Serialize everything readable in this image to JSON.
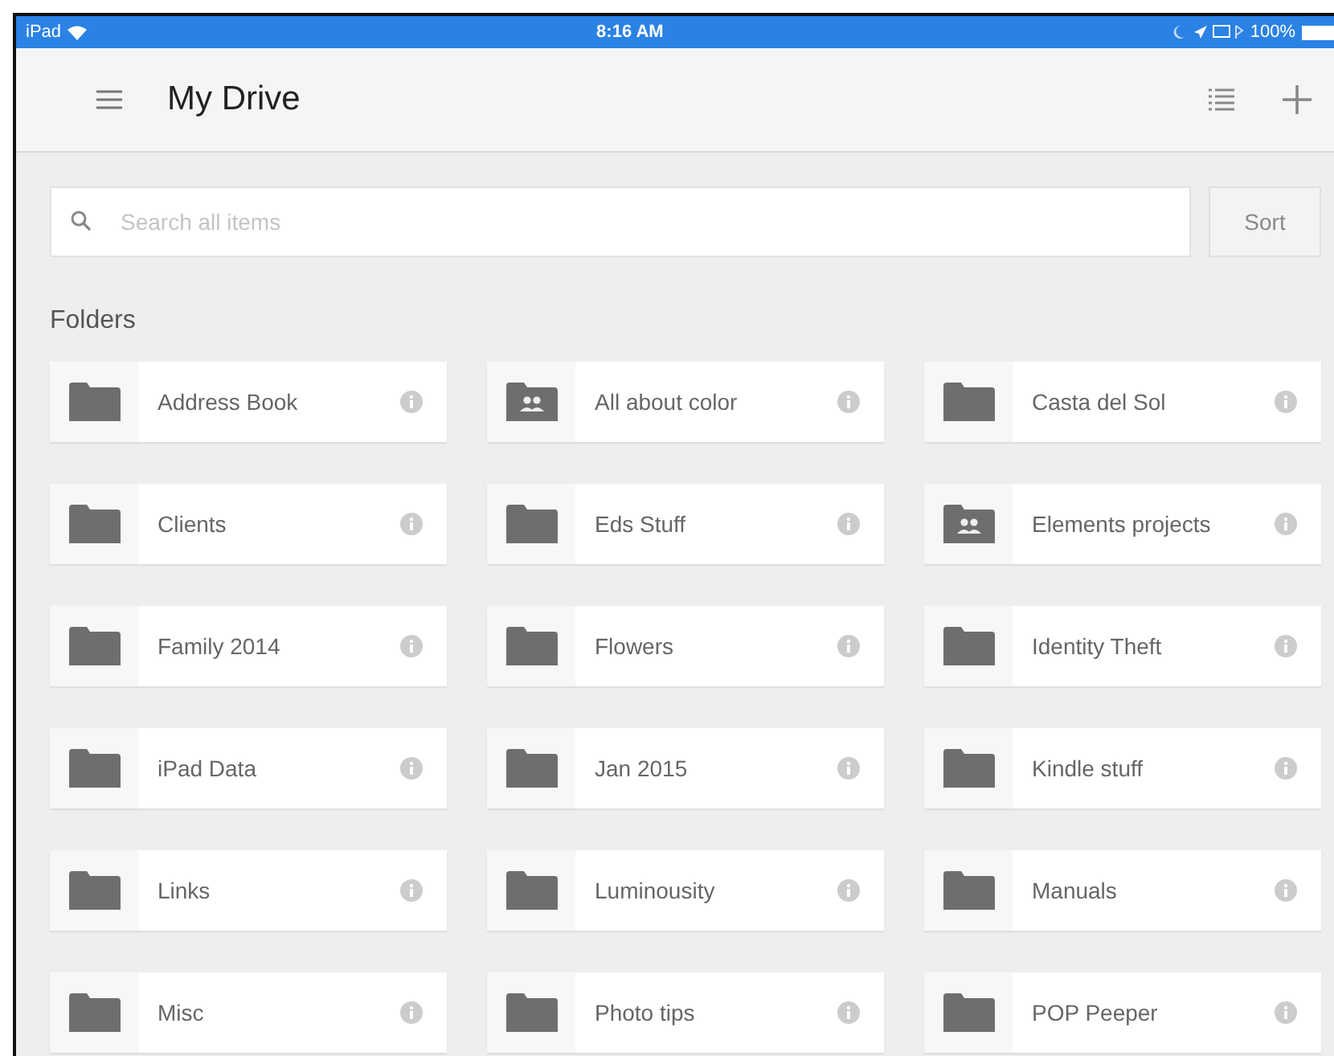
{
  "status_bar": {
    "device": "iPad",
    "time": "8:16 AM",
    "battery": "100%"
  },
  "header": {
    "title": "My Drive"
  },
  "search": {
    "placeholder": "Search all items"
  },
  "sort_button": "Sort",
  "section_title": "Folders",
  "folders": [
    {
      "name": "Address Book",
      "kind": "plain"
    },
    {
      "name": "All about color",
      "kind": "shared"
    },
    {
      "name": "Casta del Sol",
      "kind": "plain"
    },
    {
      "name": "Clients",
      "kind": "plain"
    },
    {
      "name": "Eds Stuff",
      "kind": "plain"
    },
    {
      "name": "Elements projects",
      "kind": "shared"
    },
    {
      "name": "Family 2014",
      "kind": "plain"
    },
    {
      "name": "Flowers",
      "kind": "plain"
    },
    {
      "name": "Identity Theft",
      "kind": "plain"
    },
    {
      "name": "iPad Data",
      "kind": "plain"
    },
    {
      "name": "Jan 2015",
      "kind": "plain"
    },
    {
      "name": "Kindle stuff",
      "kind": "plain"
    },
    {
      "name": "Links",
      "kind": "plain"
    },
    {
      "name": "Luminousity",
      "kind": "plain"
    },
    {
      "name": "Manuals",
      "kind": "plain"
    },
    {
      "name": "Misc",
      "kind": "plain"
    },
    {
      "name": "Photo tips",
      "kind": "plain"
    },
    {
      "name": "POP Peeper",
      "kind": "plain"
    }
  ]
}
